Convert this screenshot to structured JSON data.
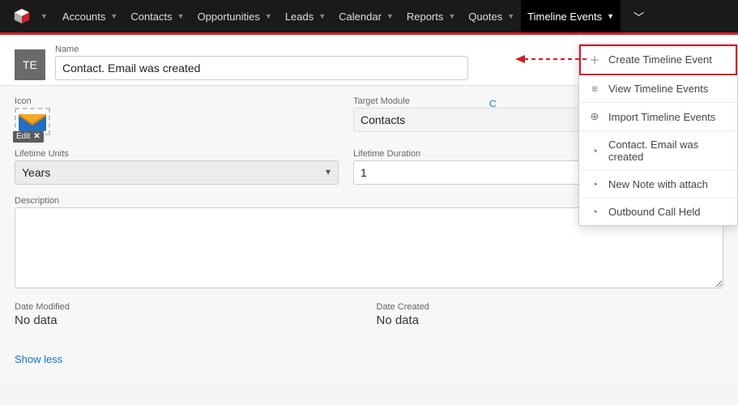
{
  "nav": {
    "items": [
      "Accounts",
      "Contacts",
      "Opportunities",
      "Leads",
      "Calendar",
      "Reports",
      "Quotes",
      "Timeline Events"
    ],
    "activeIndex": 7
  },
  "subheader": {
    "avatar_text": "TE",
    "name_label": "Name",
    "name_value": "Contact. Email was created",
    "cut_char": "C"
  },
  "form": {
    "icon_label": "Icon",
    "icon_edit_label": "Edit",
    "icon_name": "mail-icon",
    "target_module_label": "Target Module",
    "target_module_value": "Contacts",
    "lifetime_units_label": "Lifetime Units",
    "lifetime_units_value": "Years",
    "lifetime_duration_label": "Lifetime Duration",
    "lifetime_duration_value": "1",
    "description_label": "Description",
    "description_value": "",
    "date_modified_label": "Date Modified",
    "date_modified_value": "No data",
    "date_created_label": "Date Created",
    "date_created_value": "No data",
    "show_less": "Show less"
  },
  "dropdown": {
    "items": [
      {
        "icon": "plus",
        "label": "Create Timeline Event",
        "highlighted": true
      },
      {
        "icon": "list",
        "label": "View Timeline Events"
      },
      {
        "icon": "upload",
        "label": "Import Timeline Events"
      },
      {
        "icon": "clock",
        "label": "Contact. Email was created"
      },
      {
        "icon": "clock",
        "label": "New Note with attach"
      },
      {
        "icon": "clock",
        "label": "Outbound Call Held"
      }
    ]
  },
  "icon_glyphs": {
    "plus": "＋",
    "list": "≡",
    "upload": "⊕",
    "clock": "◔"
  }
}
